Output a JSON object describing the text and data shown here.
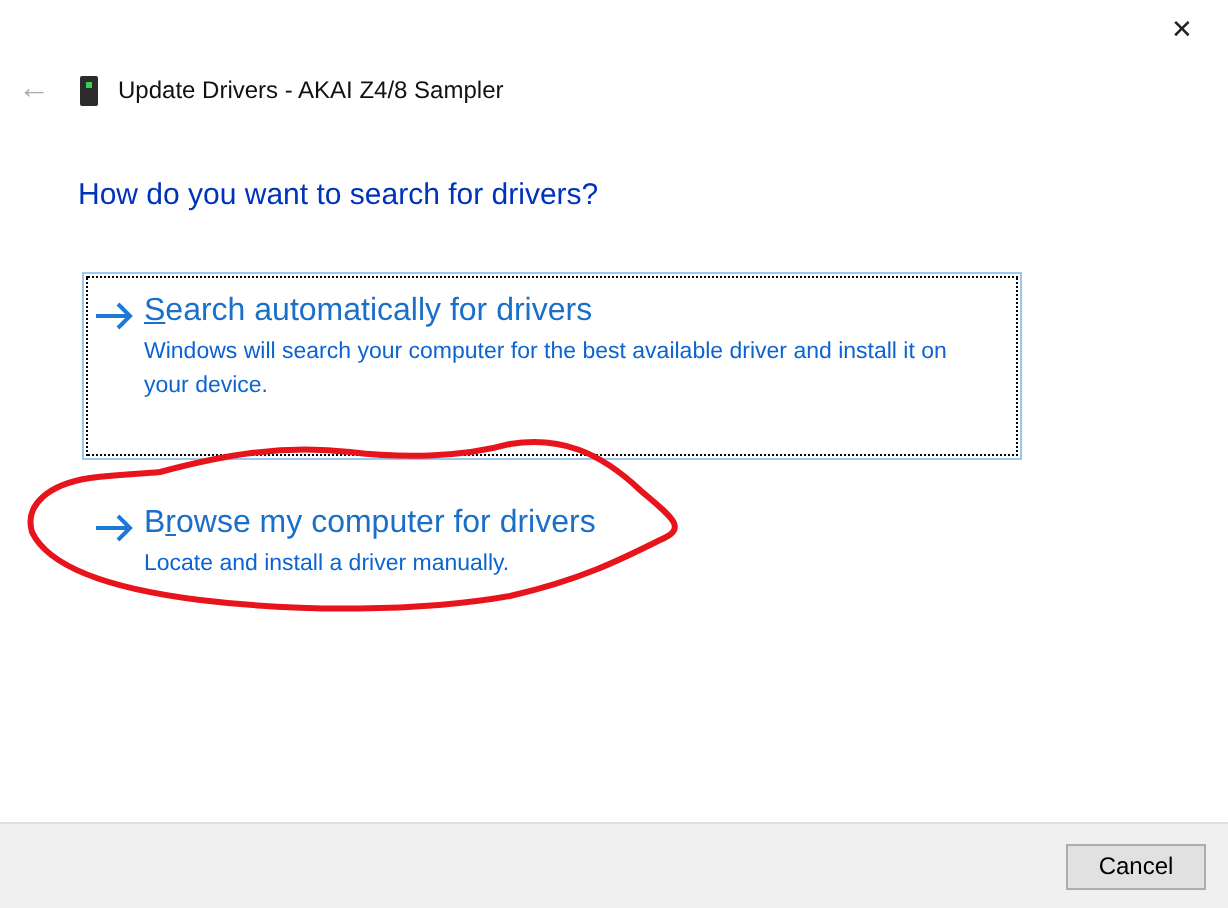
{
  "window": {
    "close": "✕",
    "back": "←",
    "title": "Update Drivers - AKAI Z4/8 Sampler"
  },
  "heading": "How do you want to search for drivers?",
  "options": [
    {
      "focused": true,
      "title": [
        {
          "text": "S",
          "underlined": true
        },
        {
          "text": "earch automatically for drivers",
          "underlined": false
        }
      ],
      "description": "Windows will search your computer for the best available driver and install it on your device."
    },
    {
      "focused": false,
      "title": [
        {
          "text": "B",
          "underlined": false
        },
        {
          "text": "r",
          "underlined": true
        },
        {
          "text": "owse my computer for drivers",
          "underlined": false
        }
      ],
      "description": "Locate and install a driver manually."
    }
  ],
  "buttons": [
    "Cancel"
  ]
}
